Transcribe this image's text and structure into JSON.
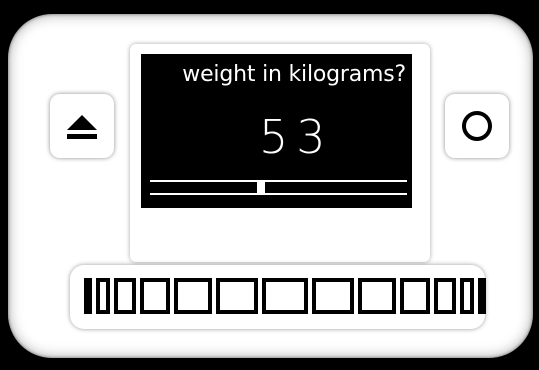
{
  "screen": {
    "question": "weight in kilograms?",
    "value": "53",
    "slider_fraction": 0.43
  },
  "buttons": {
    "eject_icon": "eject-icon",
    "circle_icon": "circle-icon"
  },
  "keypad": {
    "key_count": 13
  },
  "colors": {
    "device_body": "#ffffff",
    "screen_background": "#000000",
    "screen_text": "#ffffff"
  }
}
